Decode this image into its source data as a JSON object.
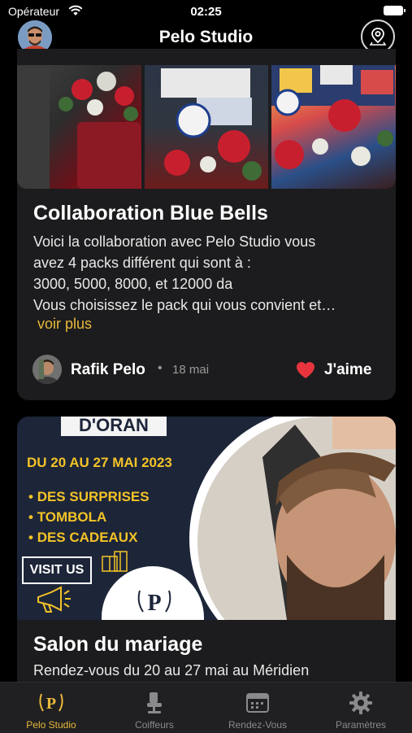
{
  "status_bar": {
    "carrier": "Opérateur",
    "time": "02:25"
  },
  "header": {
    "title": "Pelo Studio"
  },
  "posts": [
    {
      "title": "Collaboration Blue Bells",
      "body_lines": [
        "Voici la collaboration avec Pelo Studio vous",
        "avez 4 packs différent qui sont à :",
        "3000, 5000, 8000, et 12000 da",
        "Vous choisissez le pack qui vous convient et…"
      ],
      "see_more": "voir plus",
      "author": "Rafik Pelo",
      "separator": "•",
      "date": "18 mai",
      "like_label": "J'aime"
    },
    {
      "banner": {
        "title": "D'ORAN",
        "dates": "DU 20 AU 27 MAI 2023",
        "items": [
          "DES SURPRISES",
          "TOMBOLA",
          "DES CADEAUX"
        ],
        "visit": "VISIT US",
        "logo_letter": "P"
      },
      "title": "Salon du mariage",
      "body": "Rendez-vous du 20 au 27 mai au Méridien"
    }
  ],
  "tabs": [
    {
      "label": "Pelo Studio",
      "icon": "logo-icon",
      "active": true
    },
    {
      "label": "Coiffeurs",
      "icon": "barber-chair-icon",
      "active": false
    },
    {
      "label": "Rendez-Vous",
      "icon": "calendar-icon",
      "active": false
    },
    {
      "label": "Paramètres",
      "icon": "gear-icon",
      "active": false
    }
  ],
  "colors": {
    "accent": "#e8b93b",
    "card_background": "#1c1c1e",
    "like": "#e8353d",
    "banner_background": "#1d2539",
    "banner_yellow": "#f3c327"
  }
}
